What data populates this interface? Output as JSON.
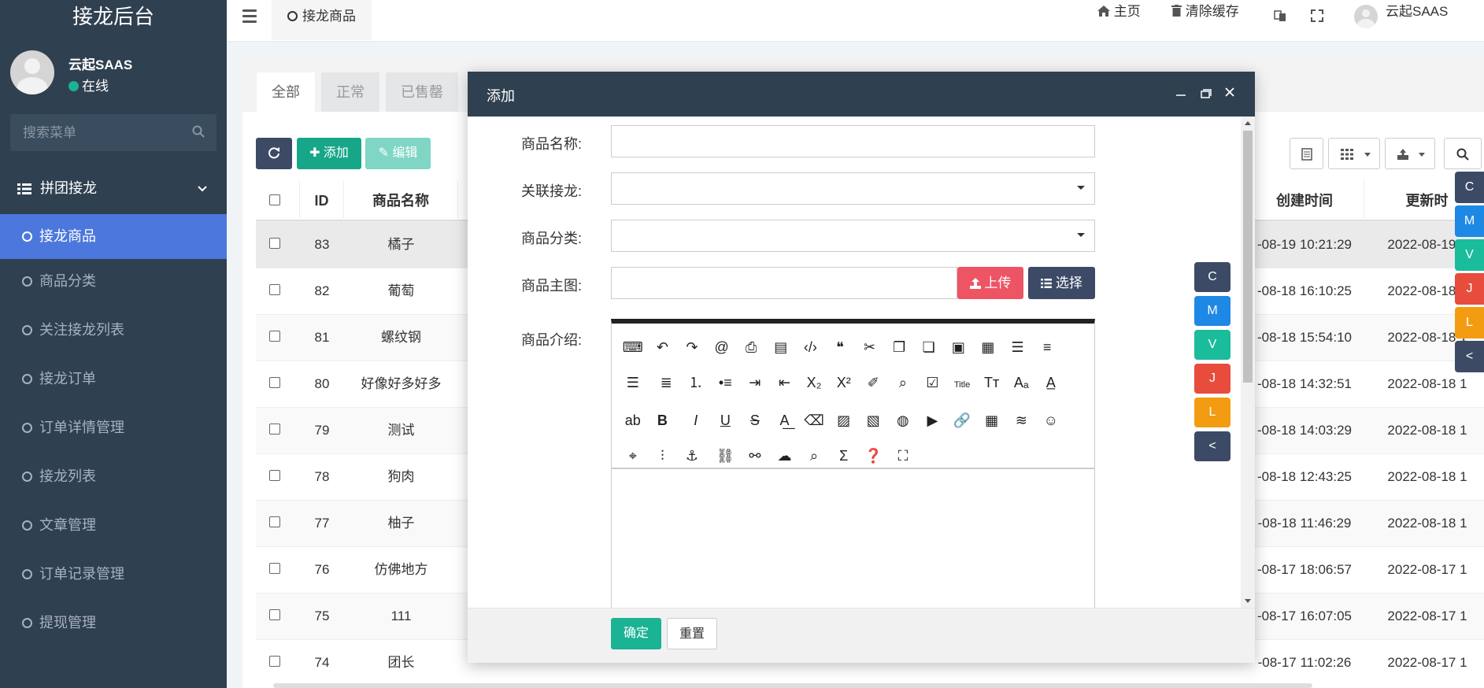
{
  "sidebar": {
    "brand": "接龙后台",
    "user_name": "云起SAAS",
    "user_status": "在线",
    "search_placeholder": "搜索菜单",
    "group_label": "拼团接龙",
    "items": [
      {
        "label": "接龙商品",
        "active": true
      },
      {
        "label": "商品分类"
      },
      {
        "label": "关注接龙列表"
      },
      {
        "label": "接龙订单"
      },
      {
        "label": "订单详情管理"
      },
      {
        "label": "接龙列表"
      },
      {
        "label": "文章管理"
      },
      {
        "label": "订单记录管理"
      },
      {
        "label": "提现管理"
      }
    ]
  },
  "topbar": {
    "tab_label": "接龙商品",
    "home_label": "主页",
    "clear_cache_label": "清除缓存",
    "user_name": "云起SAAS"
  },
  "content": {
    "filter_tabs": [
      "全部",
      "正常",
      "已售罄"
    ],
    "toolbar": {
      "add_label": "添加",
      "edit_label": "编辑"
    },
    "columns": {
      "id": "ID",
      "name": "商品名称",
      "created": "创建时间",
      "updated": "更新时"
    },
    "rows": [
      {
        "id": "83",
        "name": "橘子",
        "created": "-08-19 10:21:29",
        "updated": "2022-08-19 1"
      },
      {
        "id": "82",
        "name": "葡萄",
        "created": "-08-18 16:10:25",
        "updated": "2022-08-18 1"
      },
      {
        "id": "81",
        "name": "螺纹钢",
        "created": "-08-18 15:54:10",
        "updated": "2022-08-18 1"
      },
      {
        "id": "80",
        "name": "好像好多好多",
        "created": "-08-18 14:32:51",
        "updated": "2022-08-18 1"
      },
      {
        "id": "79",
        "name": "测试",
        "created": "-08-18 14:03:29",
        "updated": "2022-08-18 1"
      },
      {
        "id": "78",
        "name": "狗肉",
        "created": "-08-18 12:43:25",
        "updated": "2022-08-18 1"
      },
      {
        "id": "77",
        "name": "柚子",
        "created": "-08-18 11:46:29",
        "updated": "2022-08-18 1"
      },
      {
        "id": "76",
        "name": "仿佛地方",
        "created": "-08-17 18:06:57",
        "updated": "2022-08-17 1"
      },
      {
        "id": "75",
        "name": "111",
        "created": "-08-17 16:07:05",
        "updated": "2022-08-17 1"
      },
      {
        "id": "74",
        "name": "团长",
        "created": "-08-17 11:02:26",
        "updated": "2022-08-17 1"
      }
    ]
  },
  "float_buttons": [
    {
      "label": "C",
      "color": "#3c4a66"
    },
    {
      "label": "M",
      "color": "#1e88e5"
    },
    {
      "label": "V",
      "color": "#1abc9c"
    },
    {
      "label": "J",
      "color": "#e74c3c"
    },
    {
      "label": "L",
      "color": "#f39c12"
    },
    {
      "label": "<",
      "color": "#3c4a66"
    }
  ],
  "modal": {
    "title": "添加",
    "fields": {
      "name_label": "商品名称:",
      "jielong_label": "关联接龙:",
      "category_label": "商品分类:",
      "image_label": "商品主图:",
      "intro_label": "商品介绍:"
    },
    "upload_label": "上传",
    "choose_label": "选择",
    "confirm_label": "确定",
    "reset_label": "重置",
    "tools_row3_title": "Title"
  },
  "colors": {
    "sidebar_bg": "#2f4050",
    "active_blue": "#4c78dd",
    "success": "#1ab394",
    "danger": "#ed5565"
  }
}
